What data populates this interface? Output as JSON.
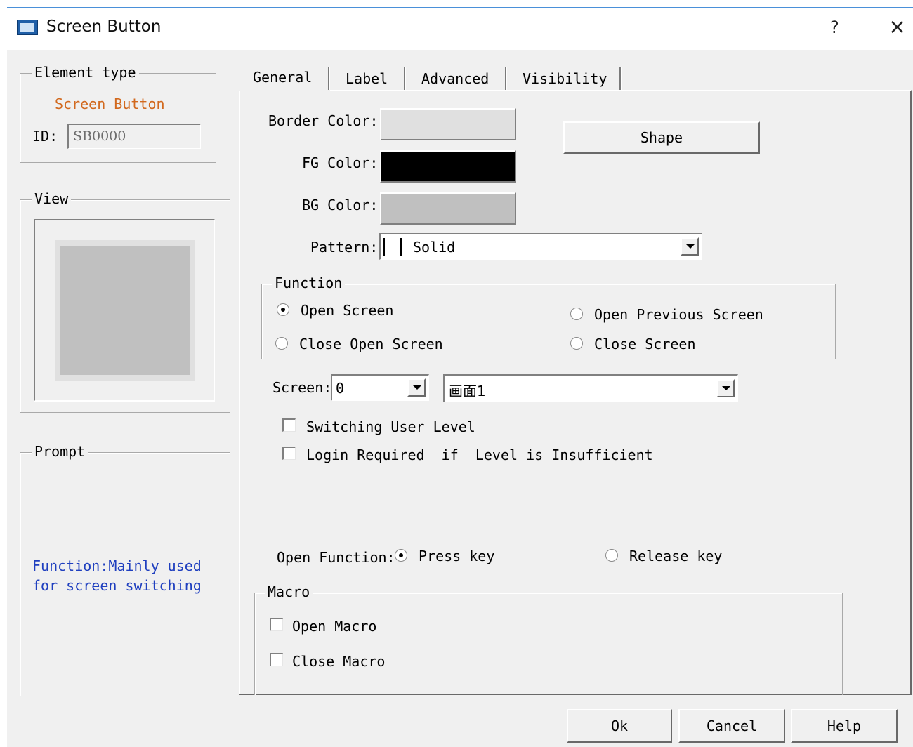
{
  "window": {
    "title": "Screen Button",
    "help_glyph": "?",
    "close_glyph": "×"
  },
  "colors": {
    "title_accent": "#4a90d9",
    "element_type_text": "#d2691e",
    "prompt_text": "#1f3fbf",
    "fg_color": "#000000",
    "bg_color": "#c0c0c0",
    "border_color": "#e0e0e0"
  },
  "element_type": {
    "legend": "Element type",
    "name": "Screen Button",
    "id_label": "ID:",
    "id_value": "SB0000"
  },
  "view": {
    "legend": "View"
  },
  "prompt": {
    "legend": "Prompt",
    "line1": "Function:Mainly used",
    "line2": "for screen switching"
  },
  "tabs": [
    {
      "label": "General",
      "active": true
    },
    {
      "label": "Label",
      "active": false
    },
    {
      "label": "Advanced",
      "active": false
    },
    {
      "label": "Visibility",
      "active": false
    }
  ],
  "general": {
    "border_color_label": "Border Color:",
    "fg_color_label": "FG Color:",
    "bg_color_label": "BG Color:",
    "pattern_label": "Pattern:",
    "pattern_value": "Solid",
    "shape_button": "Shape",
    "function": {
      "legend": "Function",
      "open_screen": "Open Screen",
      "open_previous_screen": "Open Previous Screen",
      "close_open_screen": "Close Open Screen",
      "close_screen": "Close Screen",
      "selected": "open_screen"
    },
    "screen_label": "Screen:",
    "screen_number": "0",
    "screen_name": "画面1",
    "switching_user_level": "Switching User Level",
    "login_required": "Login Required  if  Level is Insufficient",
    "open_function_label": "Open Function:",
    "press_key": "Press key",
    "release_key": "Release key",
    "open_function_selected": "press_key",
    "macro": {
      "legend": "Macro",
      "open_macro": "Open Macro",
      "close_macro": "Close Macro"
    }
  },
  "footer": {
    "ok": "Ok",
    "cancel": "Cancel",
    "help": "Help"
  }
}
